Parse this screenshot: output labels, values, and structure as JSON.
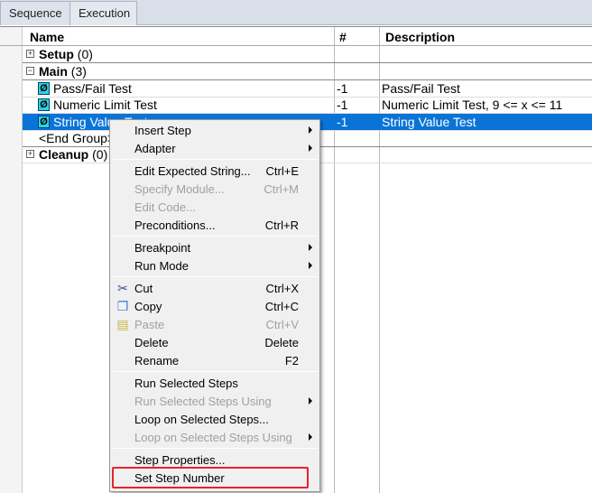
{
  "tabs": [
    "Sequence",
    "Execution"
  ],
  "columns": {
    "name": "Name",
    "num": "#",
    "desc": "Description"
  },
  "rows": [
    {
      "name": "Setup",
      "count": "(0)",
      "num": "",
      "desc": ""
    },
    {
      "name": "Main",
      "count": "(3)",
      "num": "",
      "desc": ""
    },
    {
      "name": "Pass/Fail Test",
      "num": "-1",
      "desc": "Pass/Fail Test"
    },
    {
      "name": "Numeric Limit Test",
      "num": "-1",
      "desc": "Numeric Limit Test,  9 <= x <= 11"
    },
    {
      "name": "String Value Test",
      "num": "-1",
      "desc": "String Value Test"
    },
    {
      "name": "<End Group>",
      "num": "",
      "desc": ""
    },
    {
      "name": "Cleanup",
      "count": "(0)",
      "num": "",
      "desc": ""
    }
  ],
  "menu": [
    {
      "label": "Insert Step",
      "key": "",
      "sub": true
    },
    {
      "label": "Adapter",
      "key": "",
      "sub": true
    },
    {
      "label": "Edit Expected String...",
      "key": "Ctrl+E"
    },
    {
      "label": "Specify Module...",
      "key": "Ctrl+M",
      "disabled": true
    },
    {
      "label": "Edit Code...",
      "key": "",
      "disabled": true
    },
    {
      "label": "Preconditions...",
      "key": "Ctrl+R"
    },
    {
      "label": "Breakpoint",
      "key": "",
      "sub": true
    },
    {
      "label": "Run Mode",
      "key": "",
      "sub": true
    },
    {
      "label": "Cut",
      "key": "Ctrl+X",
      "icon": "scissors"
    },
    {
      "label": "Copy",
      "key": "Ctrl+C",
      "icon": "copy"
    },
    {
      "label": "Paste",
      "key": "Ctrl+V",
      "disabled": true,
      "icon": "paste"
    },
    {
      "label": "Delete",
      "key": "Delete"
    },
    {
      "label": "Rename",
      "key": "F2"
    },
    {
      "label": "Run Selected Steps",
      "key": ""
    },
    {
      "label": "Run Selected Steps Using",
      "key": "",
      "disabled": true,
      "sub": true
    },
    {
      "label": "Loop on Selected Steps...",
      "key": ""
    },
    {
      "label": "Loop on Selected Steps Using",
      "key": "",
      "disabled": true,
      "sub": true
    },
    {
      "label": "Step Properties...",
      "key": ""
    },
    {
      "label": "Set Step Number",
      "key": "",
      "highlighted": true
    }
  ],
  "colors": {
    "selection": "#0a74d6",
    "highlight_box": "#e8222a"
  }
}
